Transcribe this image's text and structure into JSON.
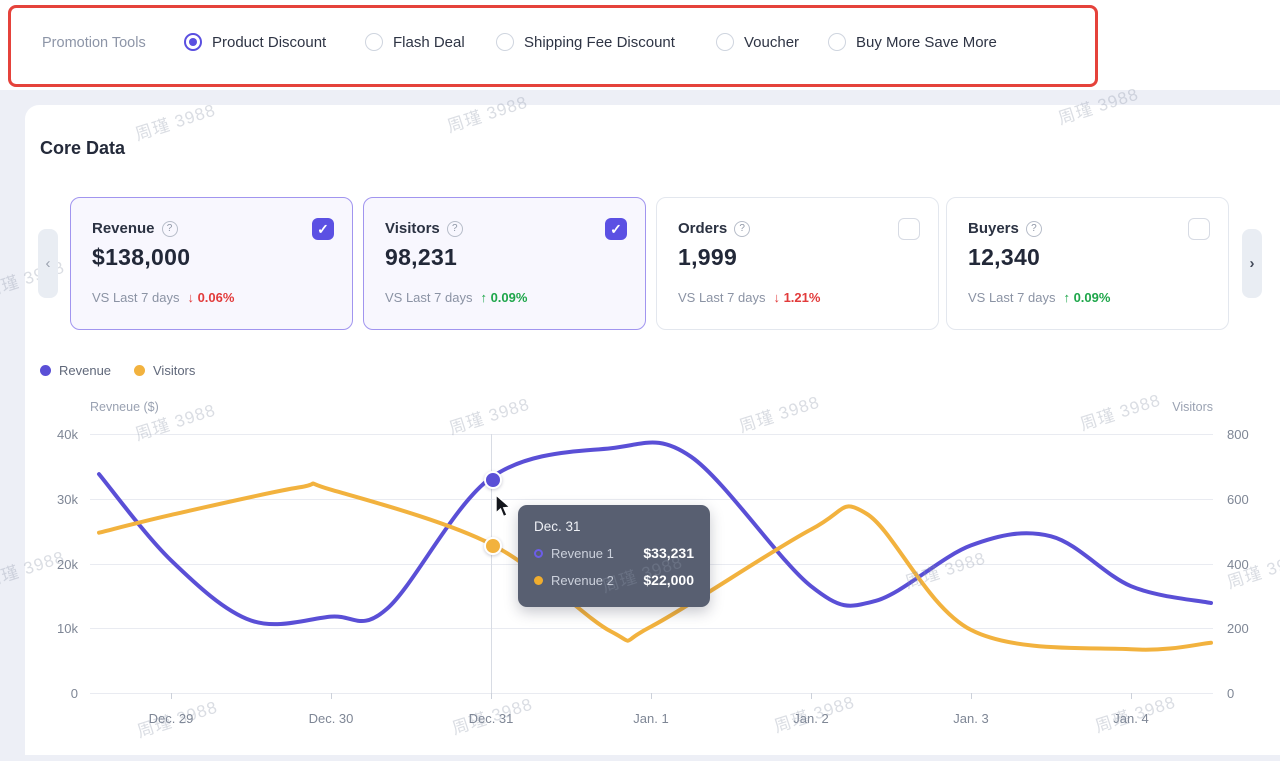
{
  "topbar": {
    "label": "Promotion Tools",
    "options": [
      {
        "label": "Product Discount",
        "selected": true
      },
      {
        "label": "Flash Deal",
        "selected": false
      },
      {
        "label": "Shipping Fee Discount",
        "selected": false
      },
      {
        "label": "Voucher",
        "selected": false
      },
      {
        "label": "Buy More Save More",
        "selected": false
      }
    ]
  },
  "core": {
    "title": "Core Data",
    "cards": [
      {
        "title": "Revenue",
        "value": "$138,000",
        "compare_label": "VS Last 7 days",
        "trend": "down",
        "trend_arrow": "↓",
        "trend_value": "0.06%",
        "checked": true,
        "selected": true,
        "check_glyph": "✓",
        "help_glyph": "?"
      },
      {
        "title": "Visitors",
        "value": "98,231",
        "compare_label": "VS Last 7 days",
        "trend": "up",
        "trend_arrow": "↑",
        "trend_value": "0.09%",
        "checked": true,
        "selected": true,
        "check_glyph": "✓",
        "help_glyph": "?"
      },
      {
        "title": "Orders",
        "value": "1,999",
        "compare_label": "VS Last 7 days",
        "trend": "down",
        "trend_arrow": "↓",
        "trend_value": "1.21%",
        "checked": false,
        "selected": false,
        "check_glyph": "",
        "help_glyph": "?"
      },
      {
        "title": "Buyers",
        "value": "12,340",
        "compare_label": "VS Last 7 days",
        "trend": "up",
        "trend_arrow": "↑",
        "trend_value": "0.09%",
        "checked": false,
        "selected": false,
        "check_glyph": "",
        "help_glyph": "?"
      }
    ]
  },
  "carousel": {
    "prev_icon": "‹",
    "next_icon": "›"
  },
  "legend": [
    {
      "label": "Revenue",
      "color": "#5a4fd6"
    },
    {
      "label": "Visitors",
      "color": "#f2b23e"
    }
  ],
  "chart_data": {
    "type": "line",
    "title": "",
    "categories": [
      "Dec. 29",
      "Dec. 30",
      "Dec. 31",
      "Jan. 1",
      "Jan. 2",
      "Jan. 3",
      "Jan. 4"
    ],
    "left_axis": {
      "label": "Revneue ($)",
      "ticks": [
        "40k",
        "30k",
        "20k",
        "10k",
        "0"
      ],
      "range": [
        0,
        40000
      ]
    },
    "right_axis": {
      "label": "Visitors",
      "ticks": [
        "800",
        "600",
        "400",
        "200",
        "0"
      ],
      "range": [
        0,
        800
      ]
    },
    "grid": true,
    "legend_position": "top-left",
    "series": [
      {
        "name": "Revenue",
        "axis": "left",
        "color": "#5a4fd6",
        "values": [
          20500,
          11800,
          33231,
          36800,
          16500,
          22800,
          16500
        ],
        "smooth_points": [
          [
            -0.45,
            33800
          ],
          [
            0,
            20500
          ],
          [
            0.5,
            11200
          ],
          [
            1,
            11800
          ],
          [
            1.35,
            13000
          ],
          [
            2,
            33231
          ],
          [
            2.75,
            37800
          ],
          [
            3.25,
            36500
          ],
          [
            4,
            16500
          ],
          [
            4.4,
            14200
          ],
          [
            5,
            22800
          ],
          [
            5.5,
            24200
          ],
          [
            6,
            16500
          ],
          [
            6.5,
            13900
          ]
        ]
      },
      {
        "name": "Visitors",
        "axis": "right",
        "color": "#f2b23e",
        "values": [
          550,
          628,
          460,
          205,
          505,
          195,
          135
        ],
        "smooth_points": [
          [
            -0.45,
            495
          ],
          [
            0,
            550
          ],
          [
            0.8,
            635
          ],
          [
            1,
            628
          ],
          [
            2,
            460
          ],
          [
            2.75,
            190
          ],
          [
            3,
            205
          ],
          [
            4,
            505
          ],
          [
            4.35,
            553
          ],
          [
            5,
            195
          ],
          [
            6,
            135
          ],
          [
            6.5,
            155
          ]
        ]
      }
    ],
    "marked_point": {
      "category": "Dec. 31",
      "revenue_value": 33231,
      "visitors_value": 460
    }
  },
  "tooltip": {
    "title": "Dec. 31",
    "rows": [
      {
        "name": "Revenue 1",
        "value": "$33,231",
        "color": "#6c5de8",
        "marker_style": "ring"
      },
      {
        "name": "Revenue 2",
        "value": "$22,000",
        "color": "#f0ad2e",
        "marker_style": "solid"
      }
    ]
  },
  "watermark": {
    "text": "周瑾 3988"
  },
  "colors": {
    "accent_purple": "#5a4fe0",
    "highlight_red": "#e5423b",
    "trend_down_red": "#e23b3b",
    "trend_up_green": "#1ea64a",
    "tooltip_bg": "#585f71"
  }
}
